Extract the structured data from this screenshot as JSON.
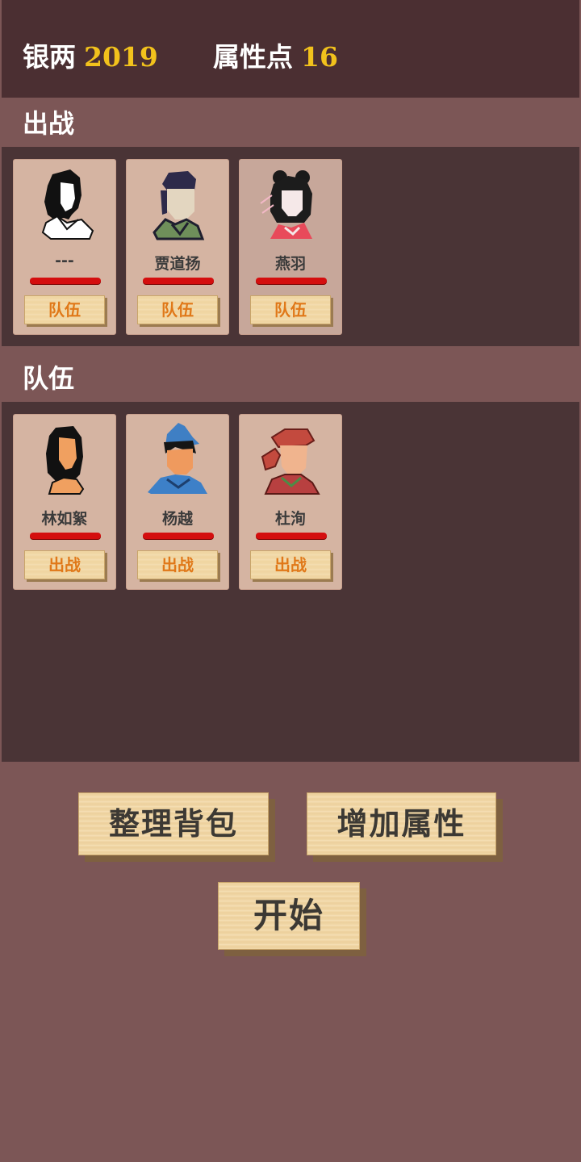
{
  "header": {
    "silver_label": "银两",
    "silver_value": "2019",
    "points_label": "属性点",
    "points_value": "16"
  },
  "deploy": {
    "title": "出战",
    "characters": [
      {
        "name": "---",
        "action": "队伍",
        "portrait": "woman-black-hair-white-collar-icon"
      },
      {
        "name": "贾道扬",
        "action": "队伍",
        "portrait": "man-headscarf-green-robe-icon"
      },
      {
        "name": "燕羽",
        "action": "队伍",
        "portrait": "woman-hair-buns-red-dress-icon"
      }
    ]
  },
  "team": {
    "title": "队伍",
    "characters": [
      {
        "name": "林如絮",
        "action": "出战",
        "portrait": "woman-long-hair-orange-robe-icon"
      },
      {
        "name": "杨越",
        "action": "出战",
        "portrait": "man-blue-hat-blue-robe-icon"
      },
      {
        "name": "杜洵",
        "action": "出战",
        "portrait": "man-red-turban-red-robe-icon"
      }
    ]
  },
  "actions": {
    "organize_bag": "整理背包",
    "add_attributes": "增加属性",
    "start": "开始"
  },
  "colors": {
    "top_bar": "#4b2f32",
    "section_bg": "#7c5656",
    "panel_bg": "#4a3436",
    "card_bg": "#d5b4a2",
    "number_accent": "#f2c21c",
    "button_text_orange": "#e07818",
    "hp_red": "#d40e0e"
  }
}
